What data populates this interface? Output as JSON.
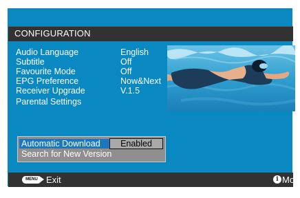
{
  "header": {
    "title": "CONFIGURATION"
  },
  "settings": [
    {
      "label": "Audio Language",
      "value": "English"
    },
    {
      "label": "Subtitle",
      "value": "Off"
    },
    {
      "label": "Favourite Mode",
      "value": "Off"
    },
    {
      "label": "EPG Preference",
      "value": "Now&Next"
    },
    {
      "label": "Receiver Upgrade",
      "value": "V.1.5"
    },
    {
      "label": "Parental Settings",
      "value": ""
    }
  ],
  "upgrade_panel": {
    "options": [
      {
        "label": "Automatic Download",
        "value": "Enabled",
        "selected": true
      },
      {
        "label": "Search for New Version",
        "value": ""
      }
    ]
  },
  "footer": {
    "menu_button_text": "MENU",
    "exit_label": "Exit",
    "info_icon_text": "i",
    "more_label": "More"
  },
  "preview_image": {
    "subject": "swimmer-underwater"
  },
  "colors": {
    "background": "#0a88c2",
    "bars": "#323232",
    "selected": "#1a78c2",
    "panel": "#8f8f8f"
  }
}
